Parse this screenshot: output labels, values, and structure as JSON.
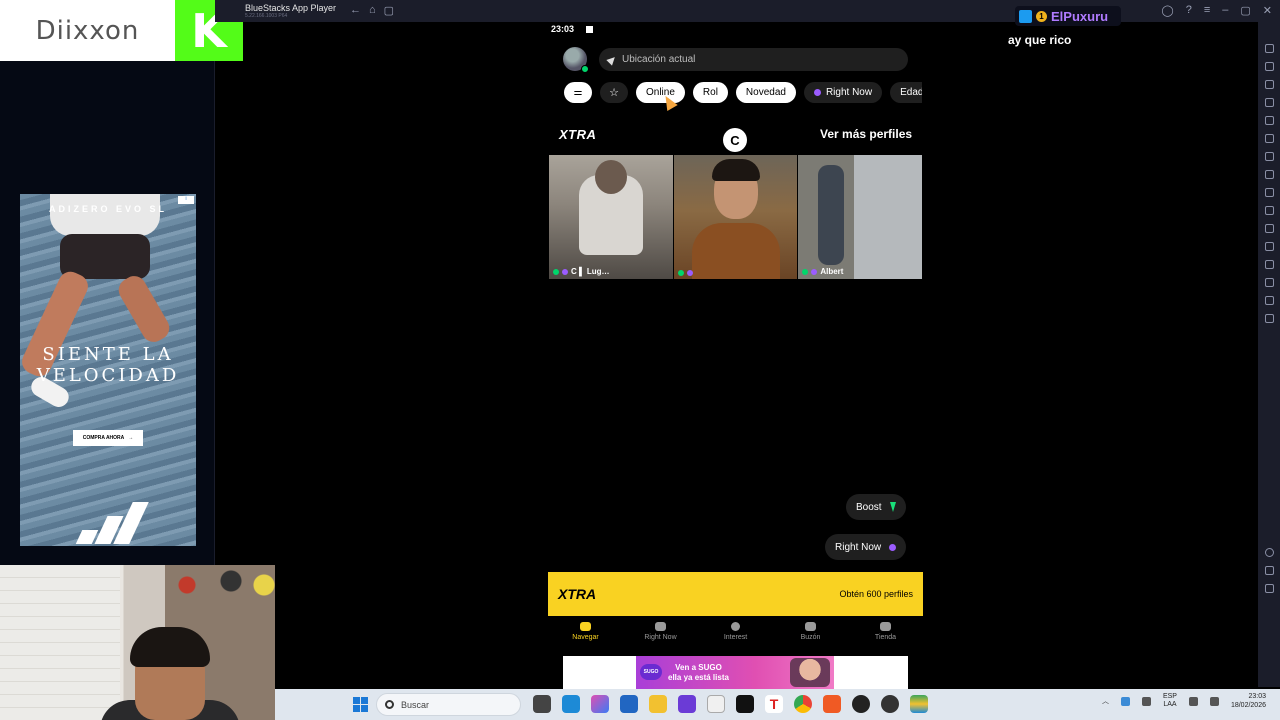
{
  "stream": {
    "logo_text": "Diixxon",
    "k_letter": "K",
    "tag_name": "ElPuxuru",
    "tag_badge": "1",
    "chat_message": "ay que rico"
  },
  "emulator": {
    "title": "BlueStacks App Player",
    "version": "5.22.166.1003  P64",
    "accent": "#1b1d2a"
  },
  "phone": {
    "time": "23:03",
    "location_placeholder": "Ubicación actual",
    "filters": [
      "Online",
      "Rol",
      "Novedad",
      "Right Now",
      "Edad"
    ],
    "xtra_label": "XTRA",
    "see_more": "Ver más perfiles",
    "loader_glyph": "C",
    "profiles": [
      {
        "name": "C ▌ Lug…"
      },
      {
        "name": ""
      },
      {
        "name": "Albert"
      }
    ],
    "boost_label": "Boost",
    "right_now_label": "Right Now",
    "banner": {
      "logo": "XTRA",
      "cta": "Obtén 600 perfiles"
    },
    "nav": [
      {
        "label": "Navegar",
        "icon": "grindr-mask-icon"
      },
      {
        "label": "Right Now",
        "icon": "right-now-icon"
      },
      {
        "label": "Interest",
        "icon": "interest-icon"
      },
      {
        "label": "Buzón",
        "icon": "inbox-icon"
      },
      {
        "label": "Tienda",
        "icon": "store-icon"
      }
    ],
    "bottom_ad": {
      "logo": "SUGO",
      "line1": "Ven a SUGO",
      "line2": "ella ya está lista"
    },
    "accent_yellow": "#f9d222",
    "online_green": "#00d66b",
    "right_now_purple": "#9b5cff"
  },
  "side_ad": {
    "brand": "ADIZERO EVO SL",
    "headline_1": "SIENTE LA",
    "headline_2": "VELOCIDAD",
    "cta": "COMPRA AHORA",
    "info": "i"
  },
  "taskbar": {
    "search_placeholder": "Buscar",
    "lang_1": "ESP",
    "lang_2": "LAA",
    "time": "23:03",
    "date": "18/02/2026"
  }
}
